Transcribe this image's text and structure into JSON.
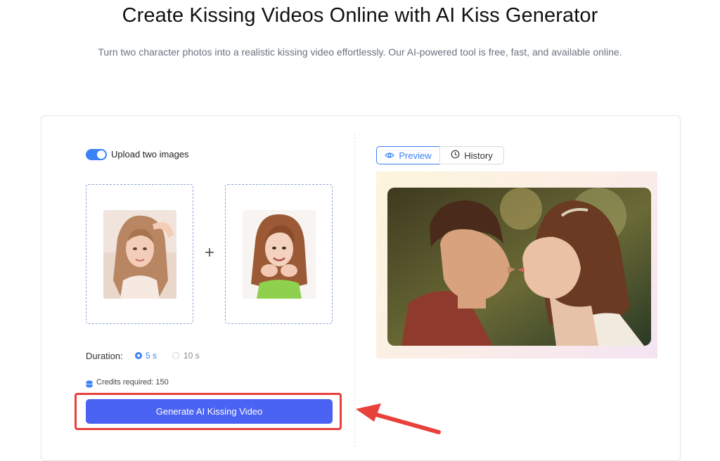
{
  "hero": {
    "title": "Create Kissing Videos Online with AI Kiss Generator",
    "subtitle": "Turn two character photos into a realistic kissing video effortlessly. Our AI-powered tool is free, fast, and available online."
  },
  "upload": {
    "toggle_label": "Upload two images",
    "toggle_on": true,
    "plus_symbol": "+"
  },
  "duration": {
    "label": "Duration:",
    "options": [
      "5 s",
      "10 s"
    ],
    "selected": "5 s"
  },
  "credits": {
    "icon": "coins-icon",
    "text": "Credits required: 150"
  },
  "generate": {
    "label": "Generate AI Kissing Video"
  },
  "tabs": {
    "preview": "Preview",
    "history": "History",
    "active": "Preview"
  },
  "colors": {
    "accent": "#3b82f6",
    "button": "#4a63f2",
    "highlight": "#e8413b"
  }
}
